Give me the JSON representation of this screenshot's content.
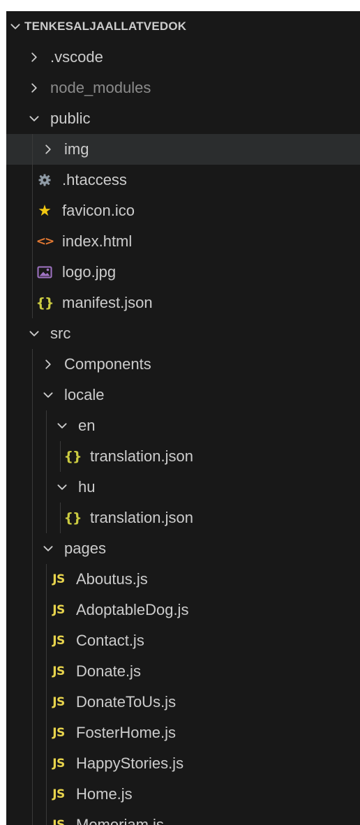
{
  "explorer": {
    "title": "TENKESALJAALLATVEDOK",
    "items": [
      {
        "label": ".vscode",
        "type": "folder",
        "expanded": false,
        "depth": 0,
        "dim": false,
        "icon": "chevron-right-icon"
      },
      {
        "label": "node_modules",
        "type": "folder",
        "expanded": false,
        "depth": 0,
        "dim": true,
        "icon": "chevron-right-icon"
      },
      {
        "label": "public",
        "type": "folder",
        "expanded": true,
        "depth": 0,
        "dim": false,
        "icon": "chevron-down-icon"
      },
      {
        "label": "img",
        "type": "folder",
        "expanded": false,
        "depth": 1,
        "dim": false,
        "selected": true,
        "icon": "chevron-right-icon"
      },
      {
        "label": ".htaccess",
        "type": "file",
        "depth": 1,
        "icon": "gear-icon",
        "icon_text": ""
      },
      {
        "label": "favicon.ico",
        "type": "file",
        "depth": 1,
        "icon": "star-icon",
        "icon_text": "★"
      },
      {
        "label": "index.html",
        "type": "file",
        "depth": 1,
        "icon": "html-icon",
        "icon_text": "<>"
      },
      {
        "label": "logo.jpg",
        "type": "file",
        "depth": 1,
        "icon": "image-icon",
        "icon_text": ""
      },
      {
        "label": "manifest.json",
        "type": "file",
        "depth": 1,
        "icon": "json-icon",
        "icon_text": "{}"
      },
      {
        "label": "src",
        "type": "folder",
        "expanded": true,
        "depth": 0,
        "dim": false,
        "icon": "chevron-down-icon"
      },
      {
        "label": "Components",
        "type": "folder",
        "expanded": false,
        "depth": 1,
        "dim": false,
        "icon": "chevron-right-icon"
      },
      {
        "label": "locale",
        "type": "folder",
        "expanded": true,
        "depth": 1,
        "dim": false,
        "icon": "chevron-down-icon"
      },
      {
        "label": "en",
        "type": "folder",
        "expanded": true,
        "depth": 2,
        "dim": false,
        "icon": "chevron-down-icon"
      },
      {
        "label": "translation.json",
        "type": "file",
        "depth": 3,
        "icon": "json-icon",
        "icon_text": "{}"
      },
      {
        "label": "hu",
        "type": "folder",
        "expanded": true,
        "depth": 2,
        "dim": false,
        "icon": "chevron-down-icon"
      },
      {
        "label": "translation.json",
        "type": "file",
        "depth": 3,
        "icon": "json-icon",
        "icon_text": "{}"
      },
      {
        "label": "pages",
        "type": "folder",
        "expanded": true,
        "depth": 1,
        "dim": false,
        "icon": "chevron-down-icon"
      },
      {
        "label": "Aboutus.js",
        "type": "file",
        "depth": 2,
        "icon": "js-icon",
        "icon_text": "JS"
      },
      {
        "label": "AdoptableDog.js",
        "type": "file",
        "depth": 2,
        "icon": "js-icon",
        "icon_text": "JS"
      },
      {
        "label": "Contact.js",
        "type": "file",
        "depth": 2,
        "icon": "js-icon",
        "icon_text": "JS"
      },
      {
        "label": "Donate.js",
        "type": "file",
        "depth": 2,
        "icon": "js-icon",
        "icon_text": "JS"
      },
      {
        "label": "DonateToUs.js",
        "type": "file",
        "depth": 2,
        "icon": "js-icon",
        "icon_text": "JS"
      },
      {
        "label": "FosterHome.js",
        "type": "file",
        "depth": 2,
        "icon": "js-icon",
        "icon_text": "JS"
      },
      {
        "label": "HappyStories.js",
        "type": "file",
        "depth": 2,
        "icon": "js-icon",
        "icon_text": "JS"
      },
      {
        "label": "Home.js",
        "type": "file",
        "depth": 2,
        "icon": "js-icon",
        "icon_text": "JS"
      },
      {
        "label": "Memoriam.js",
        "type": "file",
        "depth": 2,
        "icon": "js-icon",
        "icon_text": "JS"
      }
    ],
    "colors": {
      "background": "#181818",
      "text": "#cccccc",
      "dim_text": "#8b8b8b",
      "selected_row": "#2b2d2e",
      "js": "#e8d44d",
      "json": "#cbcb41",
      "html": "#e37933",
      "image": "#a074c4",
      "gear": "#8f9aa5",
      "star": "#f2c811"
    }
  }
}
